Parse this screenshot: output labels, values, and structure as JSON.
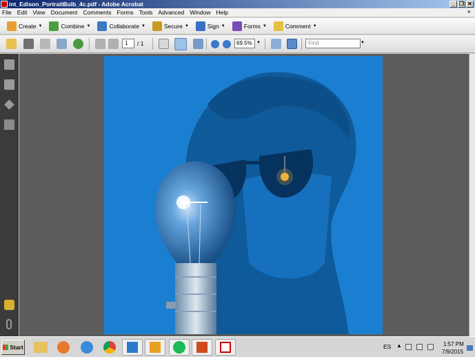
{
  "window": {
    "title": "int_Edison_PortraitBulb_4c.pdf - Adobe Acrobat",
    "minimize": "_",
    "restore": "❐",
    "close": "✕"
  },
  "menu": {
    "items": [
      "File",
      "Edit",
      "View",
      "Document",
      "Comments",
      "Forms",
      "Tools",
      "Advanced",
      "Window",
      "Help"
    ],
    "close_glyph": "×"
  },
  "tasks": [
    {
      "label": "Create",
      "icon": "create-icon",
      "color": "#e8a030"
    },
    {
      "label": "Combine",
      "icon": "combine-icon",
      "color": "#4aa040"
    },
    {
      "label": "Collaborate",
      "icon": "collaborate-icon",
      "color": "#3a7ac0"
    },
    {
      "label": "Secure",
      "icon": "lock-icon",
      "color": "#c89a20"
    },
    {
      "label": "Sign",
      "icon": "pen-icon",
      "color": "#3a6fc8"
    },
    {
      "label": "Forms",
      "icon": "forms-icon",
      "color": "#7a4ab8"
    },
    {
      "label": "Comment",
      "icon": "comment-icon",
      "color": "#e8c040"
    }
  ],
  "toolbar": {
    "page_current": "1",
    "page_total": "/ 1",
    "zoom": "69.5%",
    "find_placeholder": "Find"
  },
  "taskbar": {
    "start_label": "Start",
    "language": "ES",
    "time": "1:57 PM",
    "date": "7/9/2015"
  },
  "colors": {
    "page_bg": "#1a7fd1",
    "portrait_dark": "#0f5a9a",
    "doc_bg": "#5c5c5c"
  }
}
